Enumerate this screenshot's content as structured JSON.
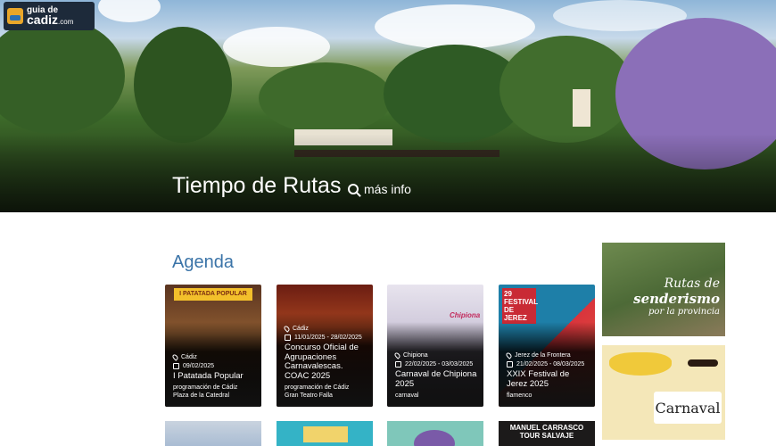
{
  "logo": {
    "line1": "guia de",
    "line2": "cadiz",
    "suffix": ".com"
  },
  "hero": {
    "title": "Tiempo de Rutas",
    "more_label": "más info",
    "icon": "search-icon"
  },
  "agenda": {
    "title": "Agenda",
    "cards": [
      {
        "location": "Cádiz",
        "date": "09/02/2025",
        "title": "I Patatada Popular",
        "sub1": "programación de Cádiz",
        "sub2": "Plaza de la Catedral",
        "poster_text": "I PATATADA POPULAR"
      },
      {
        "location": "Cádiz",
        "date": "11/01/2025 - 28/02/2025",
        "title": "Concurso Oficial de Agrupaciones Carnavalescas. COAC 2025",
        "sub1": "programación de Cádiz",
        "sub2": "Gran Teatro Falla",
        "poster_text": ""
      },
      {
        "location": "Chipiona",
        "date": "22/02/2025 - 03/03/2025",
        "title": "Carnaval de Chipiona 2025",
        "sub1": "carnaval",
        "sub2": "",
        "poster_text": "Chipiona"
      },
      {
        "location": "Jerez de la Frontera",
        "date": "21/02/2025 - 08/03/2025",
        "title": "XXIX Festival de Jerez 2025",
        "sub1": "flamenco",
        "sub2": "",
        "poster_text": "29 FESTIVAL DE JEREZ"
      }
    ]
  },
  "sidebar": {
    "banner1": {
      "line1": "Rutas de",
      "line2": "senderismo",
      "line3": "por la provincia"
    },
    "banner2": {
      "text": "Carnaval"
    }
  },
  "row2": {
    "card4_text": "MANUEL CARRASCO TOUR SALVAJE"
  }
}
